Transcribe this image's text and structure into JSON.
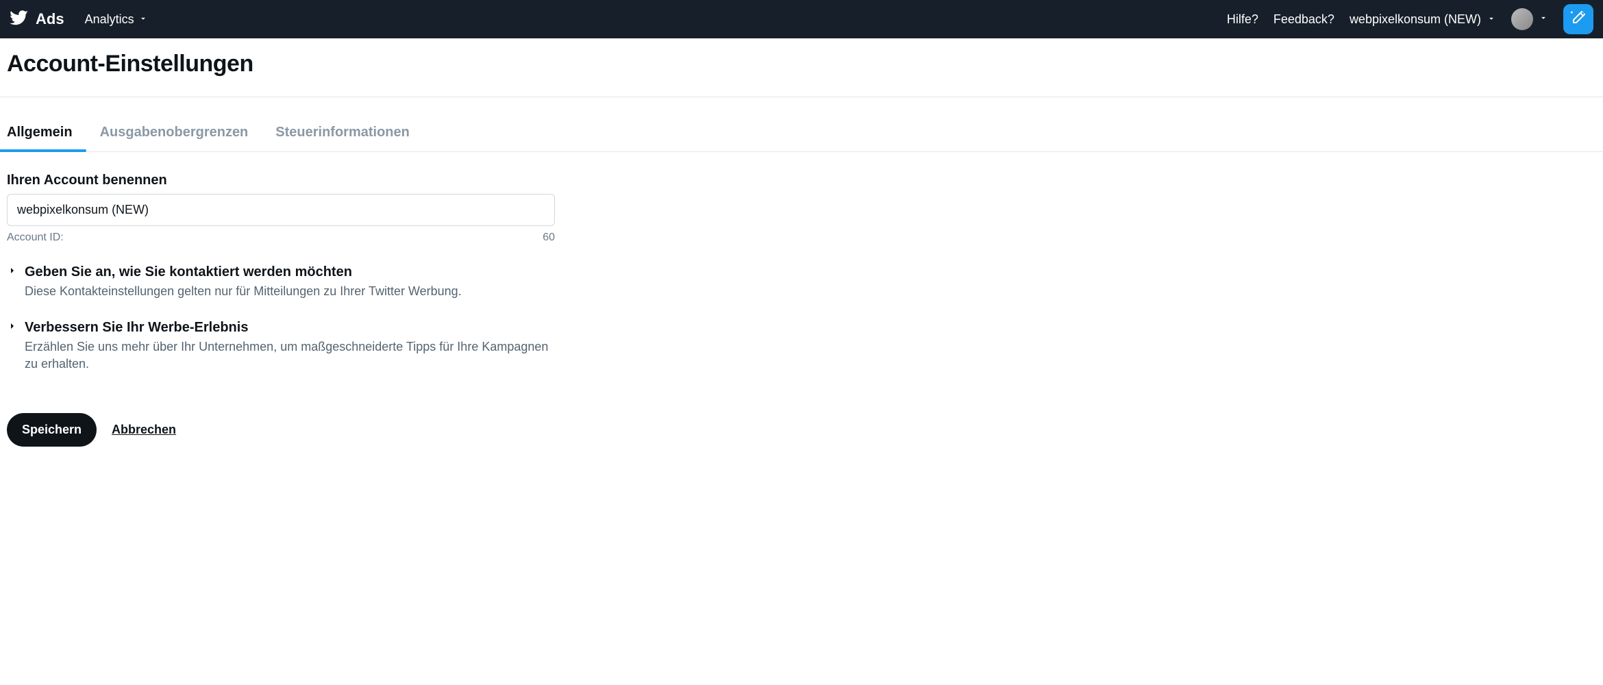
{
  "topbar": {
    "brand": "Ads",
    "analytics_label": "Analytics",
    "help_label": "Hilfe?",
    "feedback_label": "Feedback?",
    "account_display": "webpixelkonsum (NEW)"
  },
  "page": {
    "title": "Account-Einstellungen"
  },
  "tabs": {
    "general": "Allgemein",
    "spend": "Ausgabenobergrenzen",
    "tax": "Steuerinformationen"
  },
  "form": {
    "name_label": "Ihren Account benennen",
    "name_value": "webpixelkonsum (NEW)",
    "account_id_label": "Account ID:",
    "char_count": "60"
  },
  "sections": {
    "contact": {
      "title": "Geben Sie an, wie Sie kontaktiert werden möchten",
      "desc": "Diese Kontakteinstellungen gelten nur für Mitteilungen zu Ihrer Twitter Werbung."
    },
    "improve": {
      "title": "Verbessern Sie Ihr Werbe-Erlebnis",
      "desc": "Erzählen Sie uns mehr über Ihr Unternehmen, um maßgeschneiderte Tipps für Ihre Kampagnen zu erhalten."
    }
  },
  "actions": {
    "save": "Speichern",
    "cancel": "Abbrechen"
  }
}
